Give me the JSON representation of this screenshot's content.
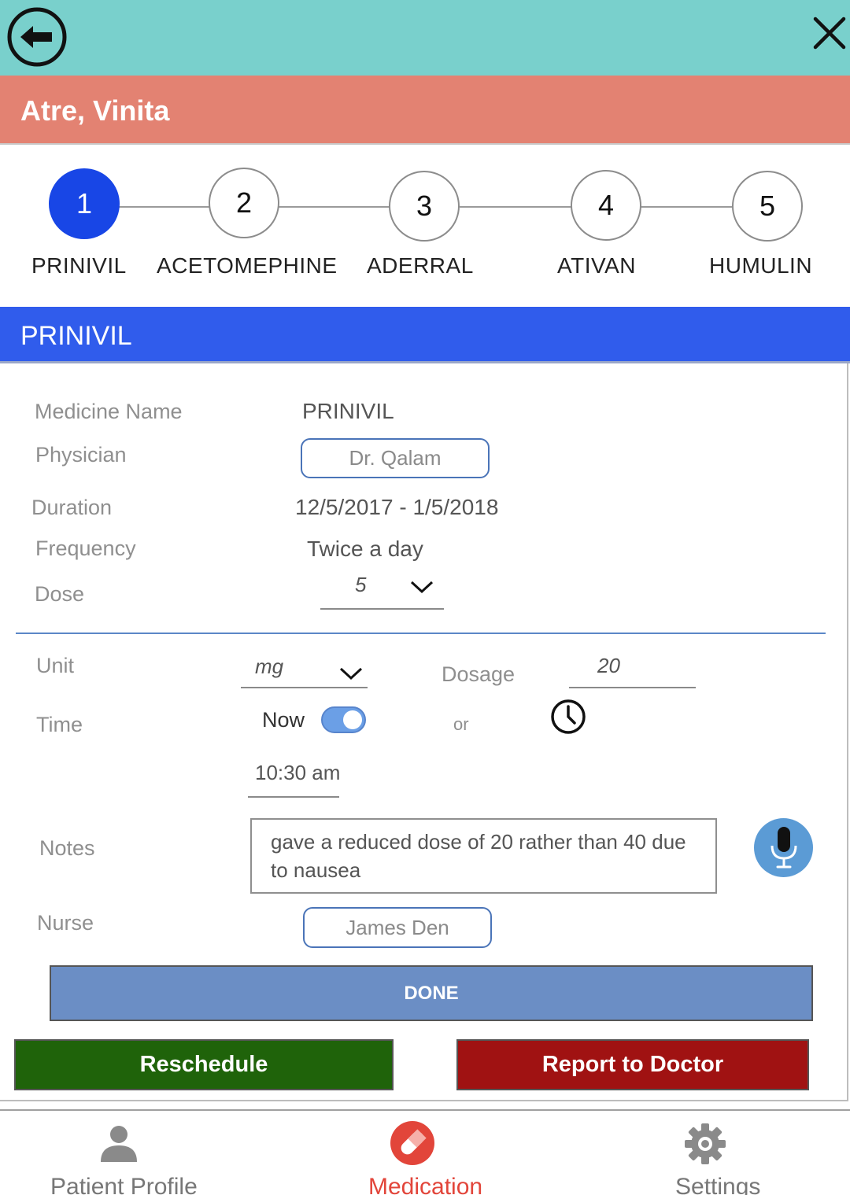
{
  "header": {
    "back_icon": "back-arrow-circle-icon",
    "close_icon": "close-x-icon"
  },
  "patient": {
    "name": "Atre, Vinita"
  },
  "steps": [
    {
      "number": "1",
      "label": "PRINIVIL",
      "active": true
    },
    {
      "number": "2",
      "label": "ACETOMEPHINE",
      "active": false
    },
    {
      "number": "3",
      "label": "ADERRAL",
      "active": false
    },
    {
      "number": "4",
      "label": "ATIVAN",
      "active": false
    },
    {
      "number": "5",
      "label": "HUMULIN",
      "active": false
    }
  ],
  "section": {
    "title": "PRINIVIL"
  },
  "form": {
    "medicine_name_label": "Medicine Name",
    "medicine_name_value": "PRINIVIL",
    "physician_label": "Physician",
    "physician_value": "Dr. Qalam",
    "duration_label": "Duration",
    "duration_value": "12/5/2017  -  1/5/2018",
    "frequency_label": "Frequency",
    "frequency_value": "Twice a day",
    "dose_label": "Dose",
    "dose_value": "5",
    "unit_label": "Unit",
    "unit_value": "mg",
    "dosage_label": "Dosage",
    "dosage_value": "20",
    "time_label": "Time",
    "now_label": "Now",
    "now_toggle_on": true,
    "or_label": "or",
    "time_value": "10:30 am",
    "notes_label": "Notes",
    "notes_value": "gave  a reduced dose of 20 rather than 40 due to nausea",
    "nurse_label": "Nurse",
    "nurse_value": "James Den"
  },
  "actions": {
    "done": "DONE",
    "reschedule": "Reschedule",
    "report": "Report to Doctor"
  },
  "nav": {
    "patient_profile": "Patient Profile",
    "medication": "Medication",
    "settings": "Settings",
    "active": "medication"
  },
  "colors": {
    "topbar": "#79d0cc",
    "patient_bar": "#e38272",
    "accent_blue": "#305cec",
    "done": "#6b8ec5",
    "reschedule": "#1f630a",
    "report": "#a01212",
    "nav_active": "#e2453a"
  }
}
